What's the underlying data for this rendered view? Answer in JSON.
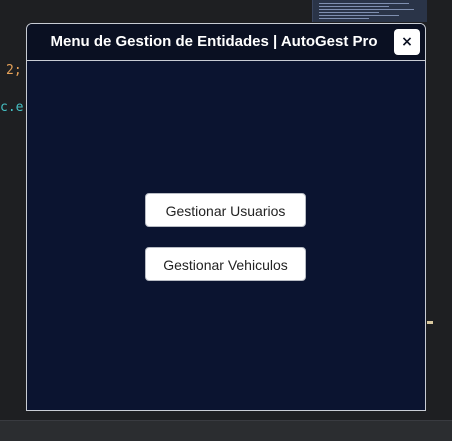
{
  "background": {
    "code_line_1": "2;",
    "code_line_2": "c.e"
  },
  "dialog": {
    "title": "Menu de Gestion de Entidades | AutoGest Pro",
    "close_label": "×",
    "buttons": {
      "users": "Gestionar Usuarios",
      "vehicles": "Gestionar Vehiculos"
    }
  },
  "colors": {
    "dialog_background": "#0b1430",
    "button_background": "#ffffff",
    "title_text": "#ffffff",
    "code_orange": "#e5a158",
    "code_teal": "#45c0c4"
  },
  "icons": {
    "close": "close-icon"
  }
}
